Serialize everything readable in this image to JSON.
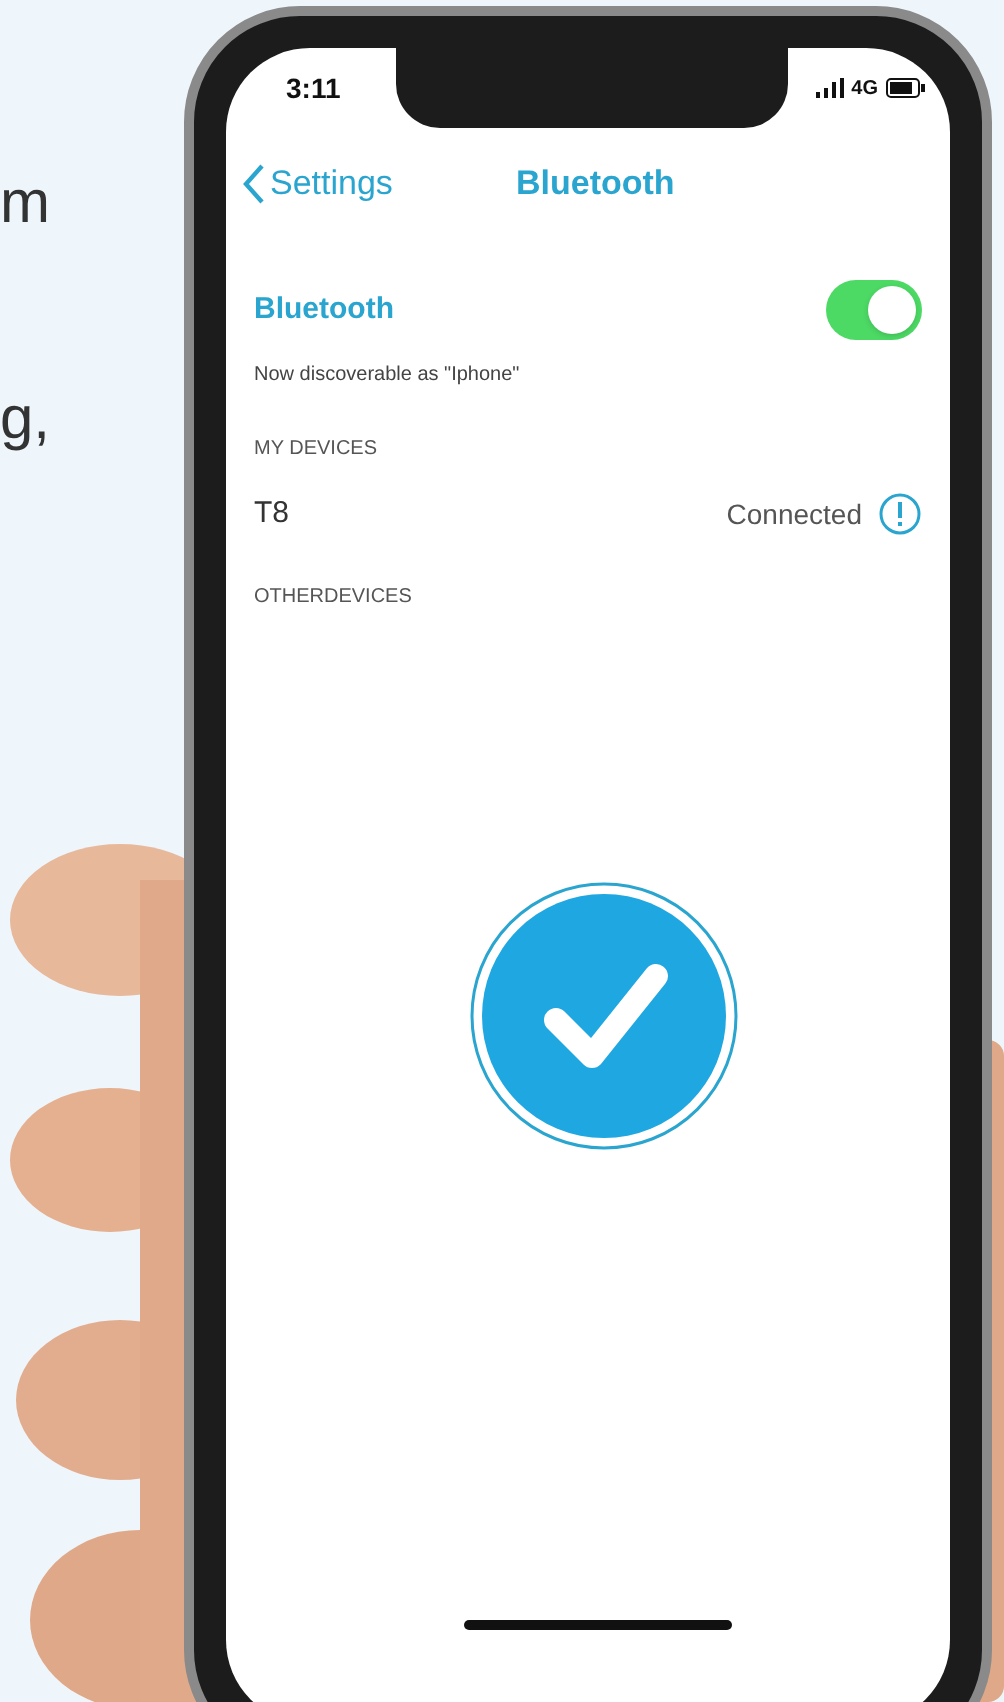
{
  "background_text": [
    "m",
    "g,"
  ],
  "status_bar": {
    "time": "3:11",
    "network": "4G"
  },
  "nav": {
    "back": "Settings",
    "title": "Bluetooth"
  },
  "bluetooth": {
    "label": "Bluetooth",
    "on": true,
    "note": "Now discoverable as \"Iphone\""
  },
  "sections": [
    {
      "header": "MY DEVICES",
      "devices": [
        {
          "name": "T8",
          "status": "Connected"
        }
      ]
    },
    {
      "header": "OTHERDEVICES"
    }
  ]
}
